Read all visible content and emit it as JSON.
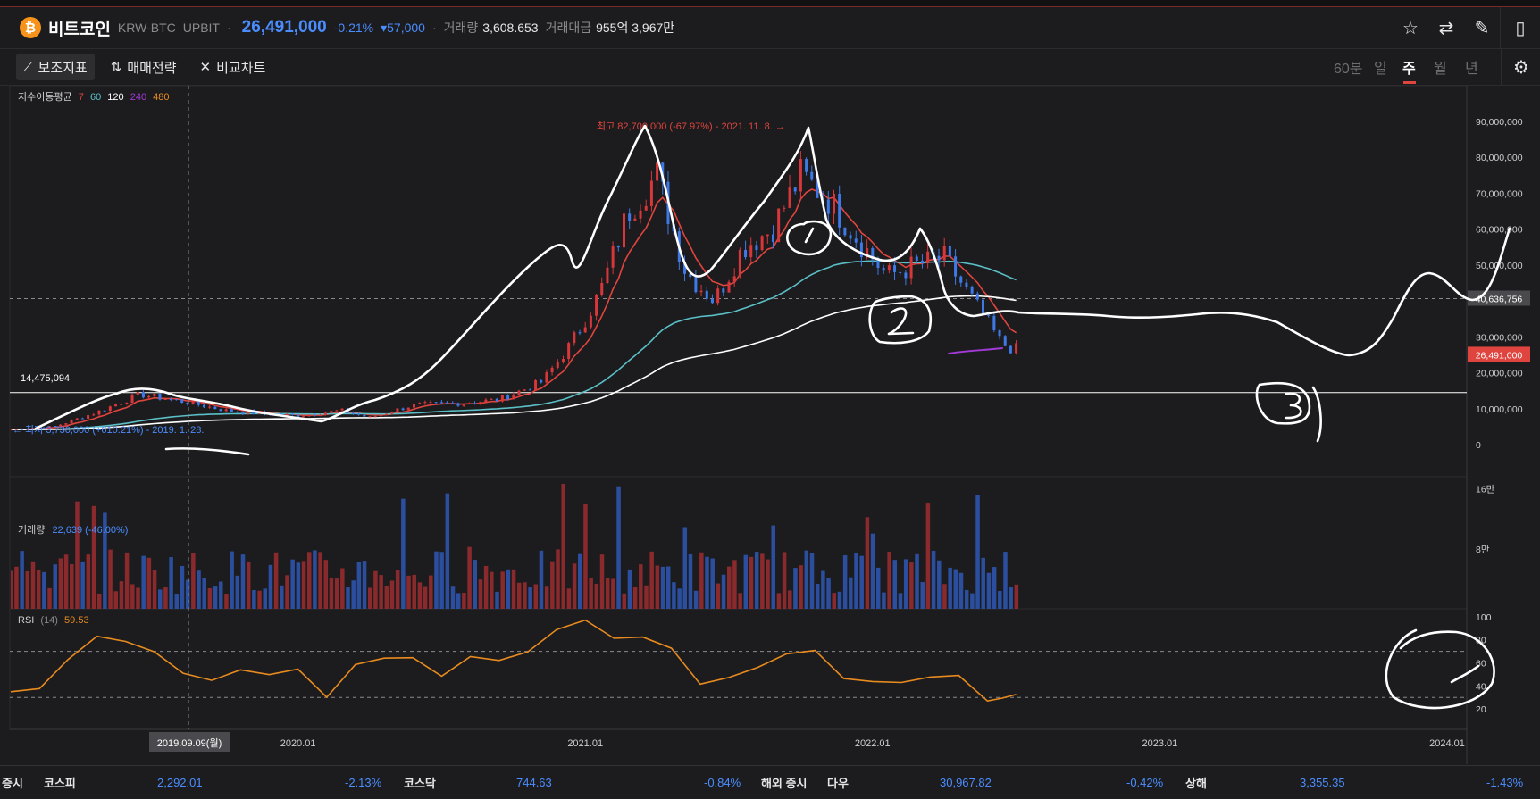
{
  "header": {
    "coin_logo": "₿",
    "coin_name": "비트코인",
    "pair": "KRW-BTC",
    "exchange": "UPBIT",
    "sep1": "·",
    "price": "26,491,000",
    "change_pct": "-0.21%",
    "change_amt": "▾57,000",
    "sep2": "·",
    "volume_label": "거래량",
    "volume_value": "3,608.653",
    "amount_label": "거래대금",
    "amount_value": "955억 3,967만",
    "icons": [
      "star-icon",
      "swap-icon",
      "edit-icon",
      "panel-icon"
    ]
  },
  "toolbar": {
    "indicators": "보조지표",
    "strategy": "매매전략",
    "compare": "비교차트",
    "periods": [
      "60분",
      "일",
      "주",
      "월",
      "년"
    ],
    "selected_period": "주"
  },
  "chart_data": {
    "type": "candlestick",
    "interval": "weekly",
    "x_ticks": [
      "2020.01",
      "2021.01",
      "2022.01",
      "2023.01",
      "2024.01"
    ],
    "x_range": [
      "2019-01",
      "2024-03"
    ],
    "crosshair_label": "2019.09.09(월)",
    "price_panel": {
      "ma_title": "지수이동평균",
      "ma_periods": [
        {
          "label": "7",
          "color": "#e0443e"
        },
        {
          "label": "60",
          "color": "#5bbfc7"
        },
        {
          "label": "120",
          "color": "#ffffff"
        },
        {
          "label": "240",
          "color": "#a23ad6"
        },
        {
          "label": "480",
          "color": "#e88b1f"
        }
      ],
      "y_ticks": [
        "90,000,000",
        "80,000,000",
        "70,000,000",
        "60,000,000",
        "50,000,000",
        "40,000,000",
        "30,000,000",
        "20,000,000",
        "10,000,000",
        "0"
      ],
      "ylim": [
        0,
        92000000
      ],
      "high_annotation": "최고 82,700,000 (-67.97%) - 2021. 11. 8. →",
      "low_annotation": "← 최저 3,730,000 (+610.21%) - 2019. 1. 28.",
      "hline_label": "14,475,094",
      "hline_value": 14475094,
      "crosshair_price": "40,636,756",
      "crosshair_price_value": 40636756,
      "current_price": "26,491,000",
      "current_price_value": 26491000,
      "series": [
        {
          "name": "close_approx",
          "x": [
            2019.0,
            2019.15,
            2019.3,
            2019.45,
            2019.6,
            2019.75,
            2019.9,
            2020.0,
            2020.15,
            2020.25,
            2020.4,
            2020.55,
            2020.7,
            2020.85,
            2020.95,
            2021.05,
            2021.15,
            2021.25,
            2021.35,
            2021.45,
            2021.55,
            2021.65,
            2021.75,
            2021.85,
            2021.95,
            2022.05,
            2022.15,
            2022.25,
            2022.35,
            2022.45,
            2022.5
          ],
          "y": [
            4200000,
            5000000,
            9000000,
            14000000,
            12000000,
            9500000,
            8500000,
            8000000,
            9500000,
            7500000,
            11000000,
            11500000,
            12500000,
            17500000,
            28000000,
            42000000,
            65000000,
            75000000,
            48000000,
            40000000,
            55000000,
            60000000,
            75000000,
            68000000,
            57000000,
            47000000,
            50000000,
            52000000,
            40000000,
            28000000,
            26491000
          ]
        }
      ]
    },
    "volume_panel": {
      "title": "거래량",
      "value": "22,639 (-46.00%)",
      "y_ticks": [
        "16만",
        "8만"
      ],
      "ylim": [
        0,
        200000
      ]
    },
    "rsi_panel": {
      "title": "RSI",
      "period": "(14)",
      "value": "59.53",
      "y_ticks": [
        "100",
        "80",
        "60",
        "40",
        "20"
      ],
      "ylim": [
        0,
        100
      ],
      "levels": [
        70,
        30
      ],
      "x": [
        2019.0,
        2019.1,
        2019.2,
        2019.3,
        2019.4,
        2019.5,
        2019.6,
        2019.7,
        2019.8,
        2019.9,
        2020.0,
        2020.1,
        2020.2,
        2020.3,
        2020.4,
        2020.5,
        2020.6,
        2020.7,
        2020.8,
        2020.9,
        2021.0,
        2021.1,
        2021.2,
        2021.3,
        2021.4,
        2021.5,
        2021.6,
        2021.7,
        2021.8,
        2021.9,
        2022.0,
        2022.1,
        2022.2,
        2022.3,
        2022.4,
        2022.45,
        2022.5
      ],
      "y": [
        35,
        40,
        60,
        80,
        78,
        65,
        55,
        45,
        50,
        45,
        55,
        35,
        55,
        60,
        62,
        52,
        68,
        62,
        72,
        85,
        95,
        80,
        85,
        70,
        40,
        45,
        60,
        65,
        68,
        50,
        45,
        40,
        50,
        45,
        30,
        25,
        30
      ]
    }
  },
  "annotations": [
    "1",
    "2",
    "3"
  ],
  "footer": {
    "items": [
      {
        "label": "증시",
        "name": "",
        "value": "",
        "change": ""
      },
      {
        "label": "",
        "name": "코스피",
        "value": "2,292.01",
        "change": "-2.13%"
      },
      {
        "label": "",
        "name": "코스닥",
        "value": "744.63",
        "change": "-0.84%"
      },
      {
        "label": "해외 증시",
        "name": "다우",
        "value": "30,967.82",
        "change": "-0.42%"
      },
      {
        "label": "",
        "name": "상해",
        "value": "3,355.35",
        "change": "-1.43%"
      }
    ]
  }
}
